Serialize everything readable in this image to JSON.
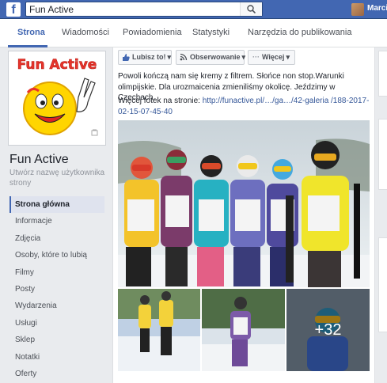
{
  "topbar": {
    "logo": "f",
    "search_value": "Fun Active",
    "username": "Marcin"
  },
  "nav": {
    "tabs": [
      "Strona",
      "Wiadomości",
      "Powiadomienia",
      "Statystyki",
      "Narzędzia do publikowania"
    ]
  },
  "page": {
    "profile_logo_text": "Fun Active",
    "name": "Fun Active",
    "create_username": "Utwórz nazwę użytkownika strony"
  },
  "menu": {
    "items": [
      "Strona główna",
      "Informacje",
      "Zdjęcia",
      "Osoby, które to lubią",
      "Filmy",
      "Posty",
      "Wydarzenia",
      "Usługi",
      "Sklep",
      "Notatki",
      "Oferty"
    ]
  },
  "actions": {
    "like": "Lubisz to!",
    "follow": "Obserwowanie",
    "more": "Więcej"
  },
  "post": {
    "text": "Powoli kończą nam się kremy z filtrem. Słońce non stop.Warunki olimpijskie. Dla urozmaicenia zmieniliśmy okolicę. Jeździmy w Czechach.",
    "more_prefix": "Więcej fotek na stronie: ",
    "link": "http://funactive.pl/…/ga…/42-galeria /188-2017-02-15-07-45-40",
    "more_photos": "+32"
  },
  "colors": {
    "brand": "#4267b2",
    "link": "#365899"
  }
}
